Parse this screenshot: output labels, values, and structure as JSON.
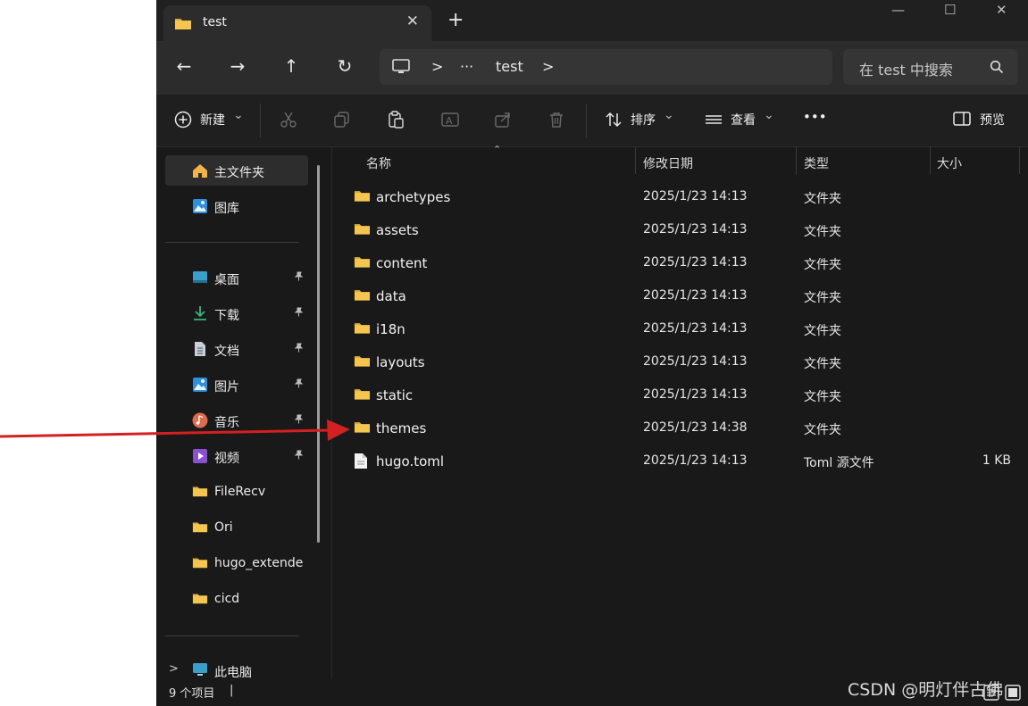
{
  "window": {
    "tab_title": "test",
    "new_tab": "+",
    "minimize": "—",
    "maximize": "☐",
    "close": "✕"
  },
  "nav": {
    "back": "←",
    "forward": "→",
    "up": "↑",
    "refresh": "↻",
    "breadcrumb": [
      ">",
      "···",
      "test",
      ">"
    ],
    "search_placeholder": "在 test 中搜索"
  },
  "toolbar": {
    "new_label": "新建",
    "sort_label": "排序",
    "view_label": "查看",
    "more": "•••",
    "preview_label": "预览",
    "chevron": "⌄"
  },
  "sidebar": {
    "top": [
      {
        "label": "主文件夹",
        "icon": "home-icon",
        "selected": true
      },
      {
        "label": "图库",
        "icon": "gallery-icon"
      }
    ],
    "quick": [
      {
        "label": "桌面",
        "icon": "desktop-icon",
        "pinned": true
      },
      {
        "label": "下载",
        "icon": "download-icon",
        "pinned": true
      },
      {
        "label": "文档",
        "icon": "document-icon",
        "pinned": true
      },
      {
        "label": "图片",
        "icon": "pictures-icon",
        "pinned": true
      },
      {
        "label": "音乐",
        "icon": "music-icon",
        "pinned": true
      },
      {
        "label": "视频",
        "icon": "video-icon",
        "pinned": true
      },
      {
        "label": "FileRecv",
        "icon": "folder-icon"
      },
      {
        "label": "Ori",
        "icon": "folder-icon"
      },
      {
        "label": "hugo_extende",
        "icon": "folder-icon"
      },
      {
        "label": "cicd",
        "icon": "folder-icon"
      }
    ],
    "this_pc": "此电脑",
    "expand": ">"
  },
  "columns": {
    "name": "名称",
    "date": "修改日期",
    "type": "类型",
    "size": "大小"
  },
  "files": [
    {
      "name": "archetypes",
      "date": "2025/1/23 14:13",
      "type": "文件夹",
      "size": "",
      "kind": "folder"
    },
    {
      "name": "assets",
      "date": "2025/1/23 14:13",
      "type": "文件夹",
      "size": "",
      "kind": "folder"
    },
    {
      "name": "content",
      "date": "2025/1/23 14:13",
      "type": "文件夹",
      "size": "",
      "kind": "folder"
    },
    {
      "name": "data",
      "date": "2025/1/23 14:13",
      "type": "文件夹",
      "size": "",
      "kind": "folder"
    },
    {
      "name": "i18n",
      "date": "2025/1/23 14:13",
      "type": "文件夹",
      "size": "",
      "kind": "folder"
    },
    {
      "name": "layouts",
      "date": "2025/1/23 14:13",
      "type": "文件夹",
      "size": "",
      "kind": "folder"
    },
    {
      "name": "static",
      "date": "2025/1/23 14:13",
      "type": "文件夹",
      "size": "",
      "kind": "folder"
    },
    {
      "name": "themes",
      "date": "2025/1/23 14:38",
      "type": "文件夹",
      "size": "",
      "kind": "folder"
    },
    {
      "name": "hugo.toml",
      "date": "2025/1/23 14:13",
      "type": "Toml 源文件",
      "size": "1 KB",
      "kind": "file"
    }
  ],
  "status": {
    "count": "9 个项目",
    "divider": "|"
  },
  "watermark": "CSDN @明灯伴古佛",
  "colors": {
    "accent_arrow": "#d32020",
    "folder": "#f5c64f",
    "background": "#191919"
  }
}
